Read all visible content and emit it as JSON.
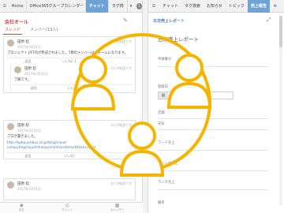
{
  "left": {
    "tabs": [
      "Home",
      "Office365グループカレンダー",
      "チャット",
      "タグ検"
    ],
    "more_label": "1",
    "section_title": "会社オール",
    "subtabs": [
      "スレッド",
      "メンバー(13人)"
    ],
    "posts": [
      {
        "name": "田原 稔",
        "date": "2017年3月31日",
        "meta": "1人が既読です",
        "body": "プロジェクト JIFT内が熟成されました。7期のメンバーは「チームになります。",
        "actions": [
          "返信",
          "いいね! 1",
          "…"
        ],
        "reply": {
          "name": "田原 稔",
          "date": "2017年3月31日",
          "meta": "2人が既読です",
          "body": "了解です。",
          "actions": [
            "返信",
            "いいね!",
            "…"
          ]
        }
      },
      {
        "name": "田原 稔",
        "date": "2017年3月31日",
        "meta": "4人が既読です",
        "body": "ブログ書きました。",
        "link": "http://www.umbus.co.jp/blog/cloud-computing/cloud/sharepoint/sharefoms/bforms.html",
        "actions": [
          "返信",
          "いいね!",
          "…"
        ]
      },
      {
        "name": "田原 稔",
        "date": "2017年3月31日",
        "meta": "4人が既読です",
        "body": "",
        "actions": [
          "返信",
          "いいね!"
        ]
      }
    ],
    "bottom_nav": [
      "会社",
      "チャット",
      "カレンダー"
    ]
  },
  "right": {
    "tabs": [
      "チャット",
      "タグ検索",
      "お知らせ",
      "トピック",
      "売上報告"
    ],
    "breadcrumb": "日次売上レポート",
    "form_title": "日次売上レポート",
    "fields": [
      "申請番号",
      "登録日",
      "店舗",
      "天気",
      "フード売上",
      "ドリンク売上",
      "ランチ売上",
      "備考"
    ],
    "date_value": "01/21/2019"
  },
  "colors": {
    "accent": "#6fa3d6",
    "title_red": "#c84646",
    "overlay": "#f5b400"
  },
  "icons": [
    "menu-icon",
    "edit-icon",
    "expand-icon",
    "calendar-icon",
    "people-icon",
    "user-icon"
  ]
}
